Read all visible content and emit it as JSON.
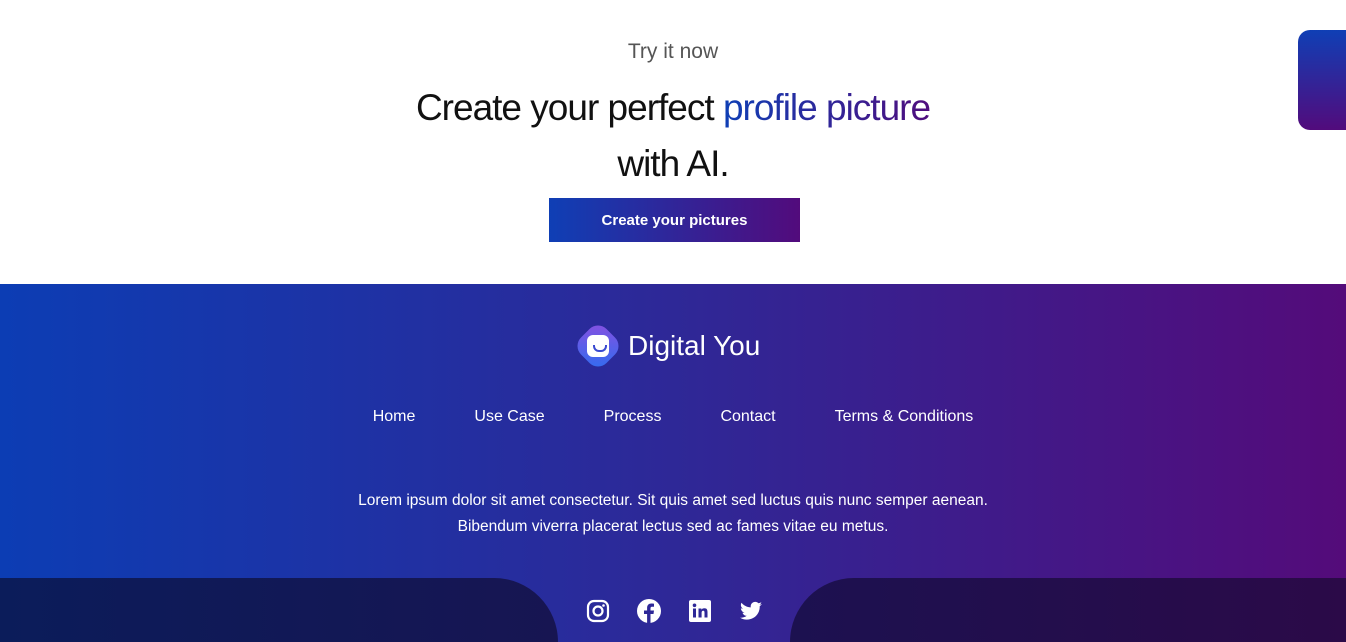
{
  "hero": {
    "kicker": "Try it now",
    "title_pre": "Create your perfect ",
    "title_highlight": "profile picture",
    "title_post": "with AI.",
    "cta": "Create your pictures"
  },
  "footer": {
    "brand": "Digital You",
    "nav": [
      {
        "label": "Home"
      },
      {
        "label": "Use Case"
      },
      {
        "label": "Process"
      },
      {
        "label": "Contact"
      },
      {
        "label": "Terms & Conditions"
      }
    ],
    "desc_line1": "Lorem ipsum dolor sit amet consectetur. Sit quis amet sed luctus quis nunc semper aenean.",
    "desc_line2": "Bibendum viverra placerat lectus sed ac fames vitae eu metus.",
    "social": [
      "instagram-icon",
      "facebook-icon",
      "linkedin-icon",
      "twitter-icon"
    ]
  },
  "colors": {
    "gradient_start": "#0f3fb5",
    "gradient_end": "#520b7c"
  }
}
